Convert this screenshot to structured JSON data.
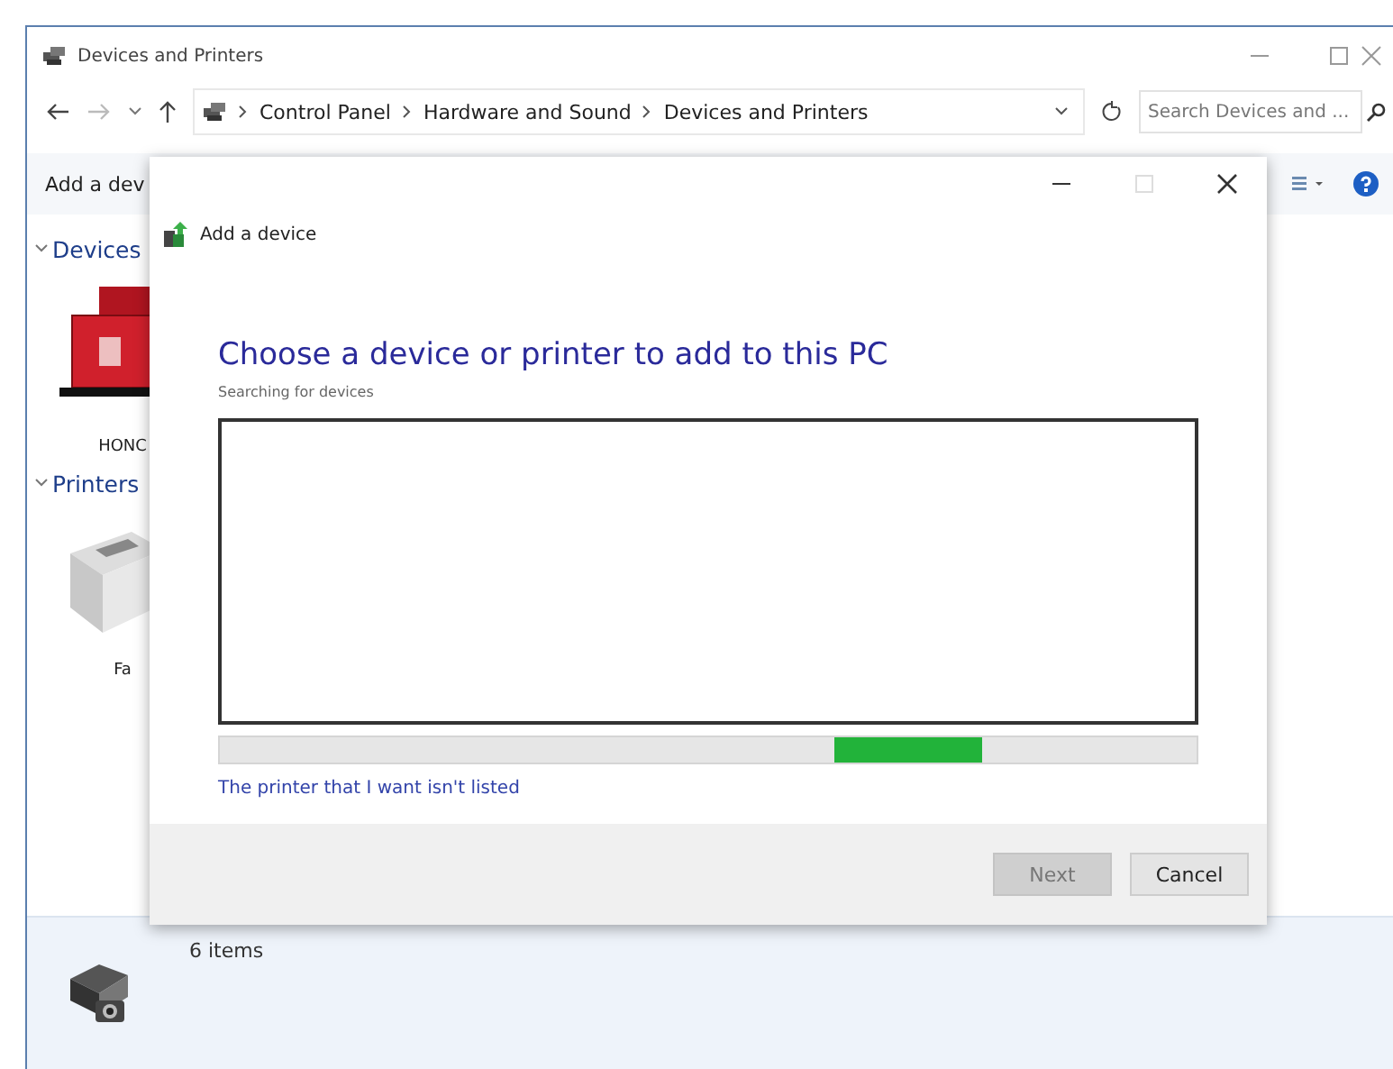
{
  "window": {
    "title": "Devices and Printers"
  },
  "address_bar": {
    "breadcrumbs": [
      "Control Panel",
      "Hardware and Sound",
      "Devices and Printers"
    ]
  },
  "search": {
    "placeholder": "Search Devices and ..."
  },
  "toolbar": {
    "items": [
      "Add a dev"
    ]
  },
  "sections": [
    {
      "title": "Devices",
      "expanded": true,
      "items": [
        {
          "label": "HONC",
          "kind": "laptop"
        }
      ]
    },
    {
      "title": "Printers",
      "expanded": true,
      "items": [
        {
          "label": "Fa",
          "kind": "printer"
        }
      ]
    }
  ],
  "status_bar": {
    "text": "6 items"
  },
  "dialog": {
    "header": "Add a device",
    "heading": "Choose a device or printer to add to this PC",
    "status": "Searching for devices",
    "progress": {
      "level": 0.78
    },
    "link": "The printer that I want isn't listed",
    "buttons": [
      {
        "label": "Next",
        "disabled": true
      },
      {
        "label": "Cancel",
        "disabled": false
      }
    ]
  }
}
